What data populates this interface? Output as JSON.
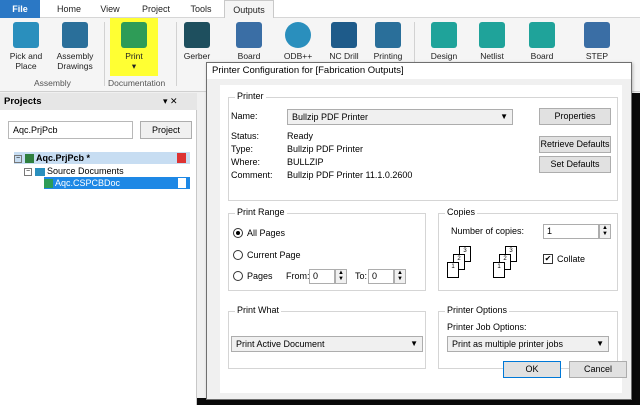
{
  "tabs": {
    "file": "File",
    "home": "Home",
    "view": "View",
    "project": "Project",
    "tools": "Tools",
    "outputs": "Outputs"
  },
  "ribbon": {
    "pick_place": "Pick and Place",
    "assembly_drawings": "Assembly Drawings",
    "print": "Print",
    "print_arrow": "▾",
    "gerber": "Gerber",
    "board_stack": "Board Stack",
    "odb": "ODB++",
    "nc_drill": "NC Drill",
    "printing": "Printing",
    "design": "Design",
    "netlist": "Netlist",
    "board": "Board",
    "step": "STEP",
    "group_assembly": "Assembly",
    "group_documentation": "Documentation",
    "print_highlight": "#ffff33"
  },
  "projects": {
    "title": "Projects",
    "pin": "▾ ✕",
    "search_value": "Aqc.PrjPcb",
    "project_button": "Project",
    "tree_root": "Aqc.PrjPcb *",
    "tree_folder": "Source Documents",
    "tree_doc": "Aqc.CSPCBDoc"
  },
  "dialog": {
    "title": "Printer Configuration for [Fabrication Outputs]",
    "printer": {
      "group": "Printer",
      "name_label": "Name:",
      "name_value": "Bullzip PDF Printer",
      "status_label": "Status:",
      "status_value": "Ready",
      "type_label": "Type:",
      "type_value": "Bullzip PDF Printer",
      "where_label": "Where:",
      "where_value": "BULLZIP",
      "comment_label": "Comment:",
      "comment_value": "Bullzip PDF Printer 11.1.0.2600",
      "properties": "Properties",
      "retrieve_defaults": "Retrieve Defaults",
      "set_defaults": "Set Defaults"
    },
    "range": {
      "group": "Print Range",
      "all": "All Pages",
      "current": "Current Page",
      "pages": "Pages",
      "from_label": "From:",
      "from_value": "0",
      "to_label": "To:",
      "to_value": "0",
      "selected": "all"
    },
    "copies": {
      "group": "Copies",
      "number_label": "Number of copies:",
      "number_value": "1",
      "collate_label": "Collate",
      "collate_checked": true,
      "page_labels": [
        "3",
        "2",
        "1",
        "3",
        "2",
        "1"
      ]
    },
    "print_what": {
      "group": "Print What",
      "value": "Print Active Document"
    },
    "printer_options": {
      "group": "Printer Options",
      "job_label": "Printer Job Options:",
      "job_value": "Print as multiple printer jobs"
    },
    "ok": "OK",
    "cancel": "Cancel"
  }
}
